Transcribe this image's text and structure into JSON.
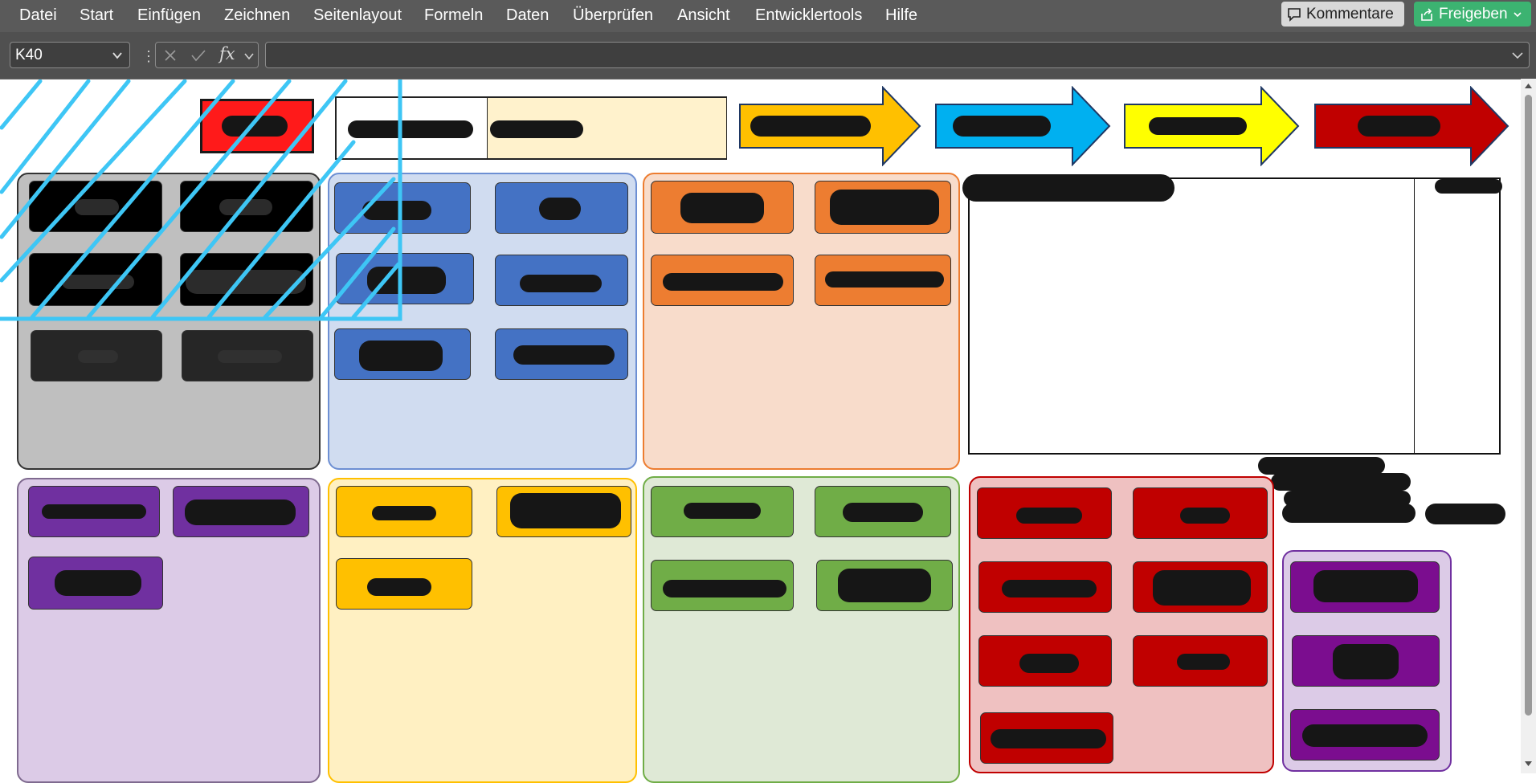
{
  "menu": {
    "items": [
      "Datei",
      "Start",
      "Einfügen",
      "Zeichnen",
      "Seitenlayout",
      "Formeln",
      "Daten",
      "Überprüfen",
      "Ansicht",
      "Entwicklertools",
      "Hilfe"
    ],
    "kommentare": "Kommentare",
    "freigeben": "Freigeben"
  },
  "formula_bar": {
    "name_box": "K40",
    "fx": "fx",
    "formula": ""
  },
  "colors": {
    "red_tile": "#ff1a1a",
    "arrow_orange": "#ffc000",
    "arrow_blue": "#00b0f0",
    "arrow_yellow": "#ffff00",
    "arrow_red": "#c00000",
    "blue_tile": "#4472c4",
    "orange_tile": "#ed7d31",
    "purple_tile": "#7030a0",
    "gold_tile": "#ffc000",
    "green_tile": "#70ad47",
    "darkred_tile": "#c00000",
    "violet_tile": "#7b0d8f",
    "hatch": "#3ec6f5"
  },
  "icons": [
    "comment-icon",
    "share-icon",
    "chevron-down-icon",
    "cancel-icon",
    "enter-icon",
    "function-icon"
  ]
}
